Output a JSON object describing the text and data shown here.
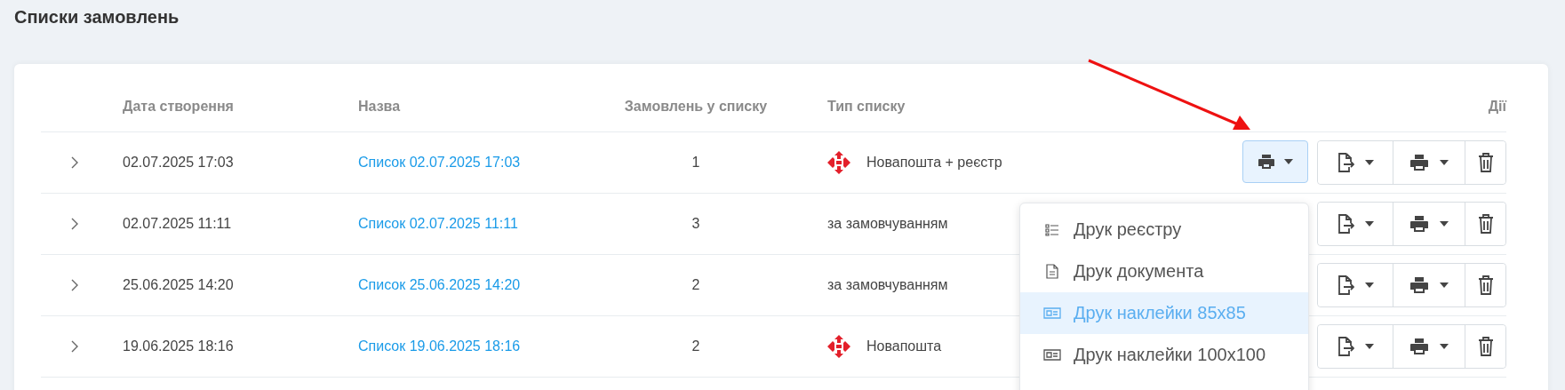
{
  "page": {
    "title": "Списки замовлень"
  },
  "table": {
    "columns": [
      "Дата створення",
      "Назва",
      "Замовлень у списку",
      "Тип списку",
      "Дії"
    ],
    "rows": [
      {
        "date": "02.07.2025 17:03",
        "name": "Список 02.07.2025 17:03",
        "count": "1",
        "type": "Новапошта + реєстр",
        "logo": true,
        "quick_print": {
          "active": true
        }
      },
      {
        "date": "02.07.2025 11:11",
        "name": "Список 02.07.2025 11:11",
        "count": "3",
        "type": "за замовчуванням",
        "logo": false
      },
      {
        "date": "25.06.2025 14:20",
        "name": "Список 25.06.2025 14:20",
        "count": "2",
        "type": "за замовчуванням",
        "logo": false
      },
      {
        "date": "19.06.2025 18:16",
        "name": "Список 19.06.2025 18:16",
        "count": "2",
        "type": "Новапошта",
        "logo": true
      }
    ]
  },
  "print_menu": {
    "items": [
      {
        "kind": "list",
        "label": "Друк реєстру",
        "selected": false
      },
      {
        "kind": "document",
        "label": "Друк документа",
        "selected": false
      },
      {
        "kind": "label",
        "label": "Друк наклейки 85x85",
        "selected": true
      },
      {
        "kind": "label",
        "label": "Друк наклейки 100x100",
        "selected": false
      }
    ]
  }
}
